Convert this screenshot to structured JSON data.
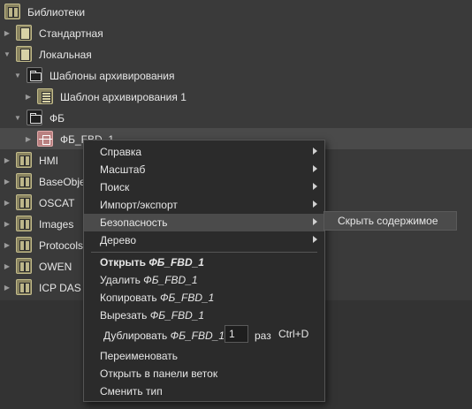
{
  "tree": {
    "items": [
      {
        "label": "Библиотеки",
        "icon": "library-icon"
      },
      {
        "label": "Стандартная",
        "icon": "standard-library-icon"
      },
      {
        "label": "Локальная",
        "icon": "local-library-icon"
      },
      {
        "label": "Шаблоны архивирования",
        "icon": "folder-icon"
      },
      {
        "label": "Шаблон архивирования 1",
        "icon": "archive-template-icon"
      },
      {
        "label": "ФБ",
        "icon": "folder-icon"
      },
      {
        "label": "ФБ_FBD_1",
        "icon": "function-block-icon"
      },
      {
        "label": "HMI",
        "icon": "library-icon"
      },
      {
        "label": "BaseObje",
        "icon": "library-icon"
      },
      {
        "label": "OSCAT",
        "icon": "library-icon"
      },
      {
        "label": "Images",
        "icon": "library-icon"
      },
      {
        "label": "Protocols",
        "icon": "library-icon"
      },
      {
        "label": "OWEN",
        "icon": "library-icon"
      },
      {
        "label": "ICP DAS",
        "icon": "library-icon"
      }
    ]
  },
  "context_menu": {
    "help": "Справка",
    "scale": "Масштаб",
    "search": "Поиск",
    "import_export": "Импорт/экспорт",
    "security": "Безопасность",
    "tree": "Дерево",
    "open_prefix": "Открыть",
    "delete_prefix": "Удалить",
    "copy_prefix": "Копировать",
    "cut_prefix": "Вырезать",
    "duplicate_prefix": "Дублировать",
    "item_name": "ФБ_FBD_1",
    "duplicate_count": "1",
    "duplicate_unit": "раз",
    "duplicate_shortcut": "Ctrl+D",
    "rename": "Переименовать",
    "open_in_branch_panel": "Открыть в панели веток",
    "change_type": "Сменить тип"
  },
  "submenu": {
    "hide_content": "Скрыть содержимое"
  }
}
